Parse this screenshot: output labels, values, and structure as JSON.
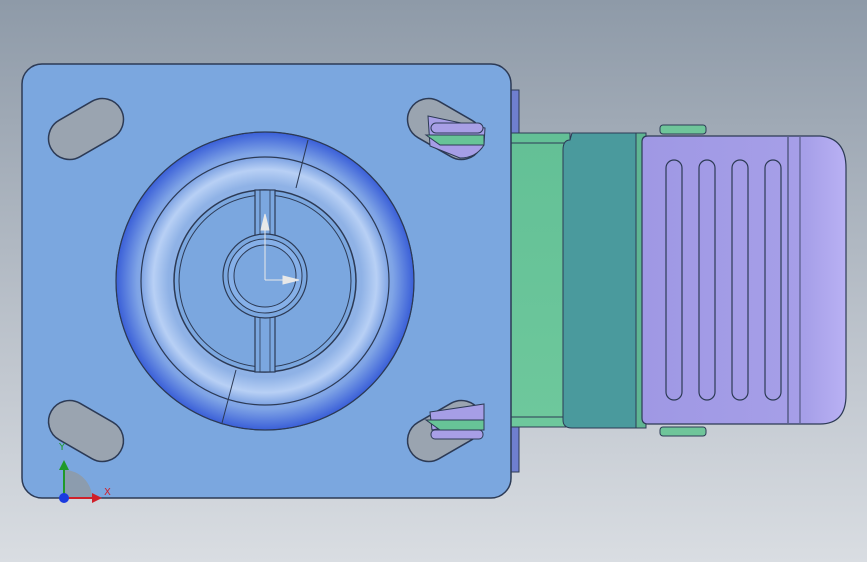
{
  "colors": {
    "plate": "#7ba7df",
    "plate_edge": "#2c3a55",
    "wheel_ring": "#8fb2e6",
    "wheel_shadow": "#3a5fd8",
    "bracket": "#67c497",
    "bracket_dark": "#4a9a9d",
    "brake": "#a49ee6",
    "brake_light": "#b6aef2",
    "slot_bg": "#9aa4b0"
  },
  "triad": {
    "x_label": "X",
    "y_label": "Y",
    "x_color": "#d0202a",
    "y_color": "#1f9a2a",
    "origin_color": "#1a3adf"
  }
}
